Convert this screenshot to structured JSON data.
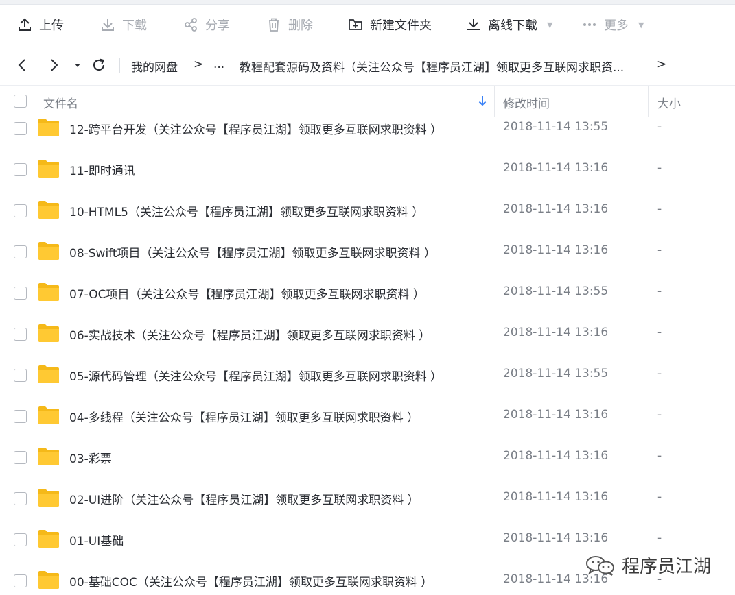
{
  "toolbar": {
    "upload": "上传",
    "download": "下载",
    "share": "分享",
    "delete": "删除",
    "new_folder": "新建文件夹",
    "offline_download": "离线下载",
    "more": "更多"
  },
  "breadcrumb": {
    "root": "我的网盘",
    "sep": ">",
    "ellipsis": "...",
    "current": "教程配套源码及资料（关注公众号【程序员江湖】领取更多互联网求职资...",
    "end": ">"
  },
  "columns": {
    "name": "文件名",
    "modified": "修改时间",
    "size": "大小"
  },
  "files": [
    {
      "name": "12-跨平台开发（关注公众号【程序员江湖】领取更多互联网求职资料 ）",
      "date": "2018-11-14 13:55",
      "size": "-"
    },
    {
      "name": "11-即时通讯",
      "date": "2018-11-14 13:16",
      "size": "-"
    },
    {
      "name": "10-HTML5（关注公众号【程序员江湖】领取更多互联网求职资料 ）",
      "date": "2018-11-14 13:16",
      "size": "-"
    },
    {
      "name": "08-Swift项目（关注公众号【程序员江湖】领取更多互联网求职资料 ）",
      "date": "2018-11-14 13:16",
      "size": "-"
    },
    {
      "name": "07-OC项目（关注公众号【程序员江湖】领取更多互联网求职资料 ）",
      "date": "2018-11-14 13:55",
      "size": "-"
    },
    {
      "name": "06-实战技术（关注公众号【程序员江湖】领取更多互联网求职资料 ）",
      "date": "2018-11-14 13:16",
      "size": "-"
    },
    {
      "name": "05-源代码管理（关注公众号【程序员江湖】领取更多互联网求职资料 ）",
      "date": "2018-11-14 13:55",
      "size": "-"
    },
    {
      "name": "04-多线程（关注公众号【程序员江湖】领取更多互联网求职资料 ）",
      "date": "2018-11-14 13:16",
      "size": "-"
    },
    {
      "name": "03-彩票",
      "date": "2018-11-14 13:16",
      "size": "-"
    },
    {
      "name": "02-UI进阶（关注公众号【程序员江湖】领取更多互联网求职资料 ）",
      "date": "2018-11-14 13:16",
      "size": "-"
    },
    {
      "name": "01-UI基础",
      "date": "2018-11-14 13:16",
      "size": "-"
    },
    {
      "name": "00-基础COC（关注公众号【程序员江湖】领取更多互联网求职资料 ）",
      "date": "2018-11-14 13:16",
      "size": "-"
    }
  ],
  "watermark": {
    "text": "程序员江湖",
    "icon": "wechat-icon"
  },
  "colors": {
    "folder": "#FFC933",
    "folder_tab": "#F5B919",
    "sort_arrow": "#3B82F6",
    "disabled_text": "#A8ACB3"
  }
}
